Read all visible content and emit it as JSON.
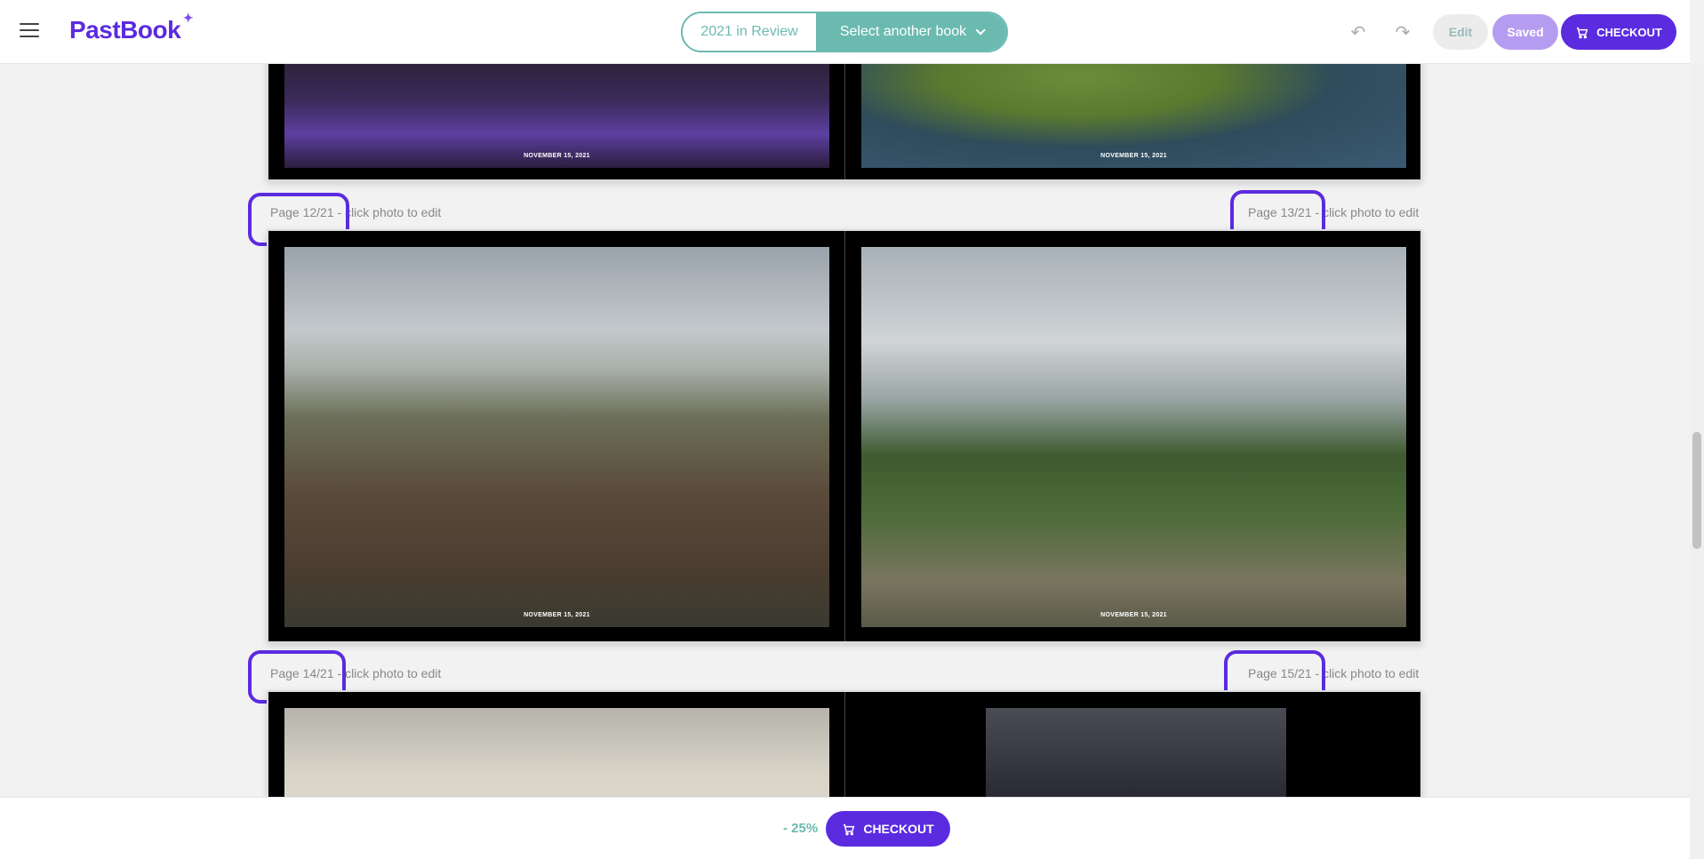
{
  "header": {
    "logo": "PastBook",
    "current_book": "2021 in Review",
    "select_book_label": "Select another book",
    "edit_label": "Edit",
    "saved_label": "Saved",
    "checkout_label": "CHECKOUT"
  },
  "spreads": [
    {
      "left": {
        "caption": "NOVEMBER 15, 2021"
      },
      "right": {
        "caption": "NOVEMBER 15, 2021"
      }
    },
    {
      "left_label_page": "Page 12/21",
      "left_label_hint": " - click photo to edit",
      "right_label_page": "Page 13/21",
      "right_label_hint": " - click photo to edit",
      "left": {
        "caption": "NOVEMBER 15, 2021"
      },
      "right": {
        "caption": "NOVEMBER 15, 2021"
      }
    },
    {
      "left_label_page": "Page 14/21",
      "left_label_hint": " - click photo to edit",
      "right_label_page": "Page 15/21",
      "right_label_hint": " - click photo to edit"
    }
  ],
  "footer": {
    "discount": "- 25%",
    "checkout_label": "CHECKOUT"
  },
  "colors": {
    "brand": "#5b2be0",
    "teal": "#6bbab0",
    "highlight": "#5b2be0"
  }
}
